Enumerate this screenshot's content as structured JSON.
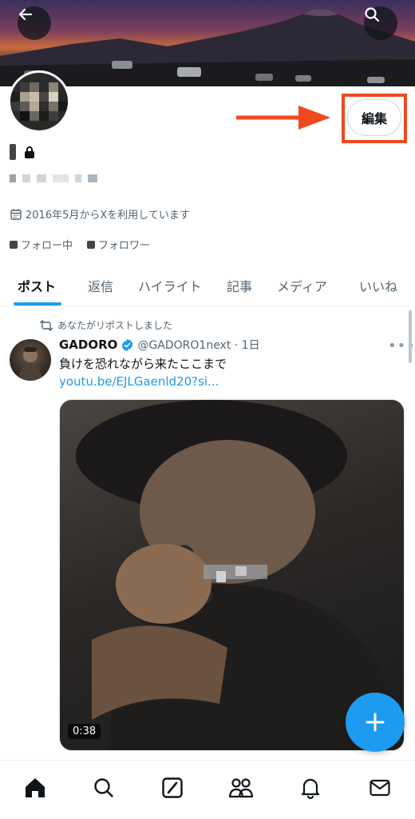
{
  "profile": {
    "edit_label": "編集",
    "joined_text": "2016年5月からXを利用しています",
    "following_label": "フォロー中",
    "followers_label": "フォロワー"
  },
  "tabs": [
    {
      "label": "ポスト",
      "active": true
    },
    {
      "label": "返信",
      "active": false
    },
    {
      "label": "ハイライト",
      "active": false
    },
    {
      "label": "記事",
      "active": false
    },
    {
      "label": "メディア",
      "active": false
    },
    {
      "label": "いいね",
      "active": false
    }
  ],
  "post": {
    "repost_text": "あなたがリポストしました",
    "author": "GADORO",
    "handle_time": "@GADORO1next · 1日",
    "text": "負けを恐れながら来たここまで",
    "link": "youtu.be/EJLGaenld20?si...",
    "duration": "0:38"
  },
  "colors": {
    "accent": "#1d9bf0",
    "highlight": "#f0491f",
    "text": "#0f1419",
    "muted": "#536471"
  },
  "icons": {
    "back": "arrow-left-icon",
    "search": "search-icon",
    "lock": "lock-icon",
    "calendar": "calendar-icon",
    "repost": "repost-icon",
    "verified": "verified-badge-icon",
    "more": "more-icon",
    "compose": "plus-icon",
    "nav": [
      "home-icon",
      "search-icon",
      "grok-icon",
      "communities-icon",
      "bell-icon",
      "mail-icon"
    ]
  }
}
